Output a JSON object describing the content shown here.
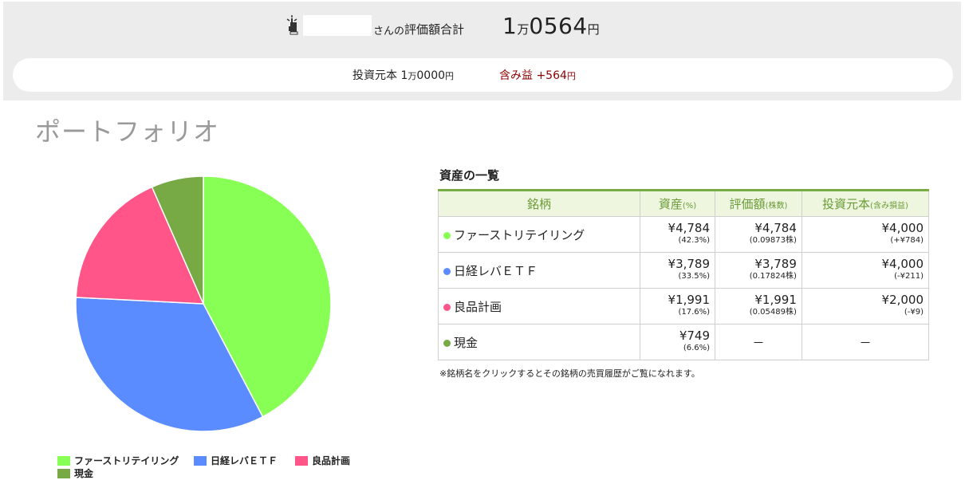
{
  "header": {
    "suffix": "さんの",
    "total_label": "評価額合計",
    "total_value": {
      "man": "1",
      "man_unit": "万",
      "rest": "0564",
      "yen": "円"
    }
  },
  "summary": {
    "principal_label": "投資元本",
    "principal": {
      "man": "1",
      "man_unit": "万",
      "rest": "0000",
      "yen": "円"
    },
    "gain_label": "含み益",
    "gain": {
      "value": "+564",
      "yen": "円"
    }
  },
  "portfolio": {
    "title": "ポートフォリオ"
  },
  "assets": {
    "title": "資産の一覧",
    "columns": [
      {
        "label": "銘柄",
        "sub": ""
      },
      {
        "label": "資産",
        "sub": "(%)"
      },
      {
        "label": "評価額",
        "sub": "(株数)"
      },
      {
        "label": "投資元本",
        "sub": "(含み損益)"
      }
    ],
    "rows": [
      {
        "name": "ファーストリテイリング",
        "color": "#88ff55",
        "asset": "¥4,784",
        "pct": "(42.3%)",
        "eval": "¥4,784",
        "shares": "(0.09873株)",
        "principal": "¥4,000",
        "pl": "(+¥784)"
      },
      {
        "name": "日経レバＥＴＦ",
        "color": "#5a8cff",
        "asset": "¥3,789",
        "pct": "(33.5%)",
        "eval": "¥3,789",
        "shares": "(0.17824株)",
        "principal": "¥4,000",
        "pl": "(-¥211)"
      },
      {
        "name": "良品計画",
        "color": "#ff5588",
        "asset": "¥1,991",
        "pct": "(17.6%)",
        "eval": "¥1,991",
        "shares": "(0.05489株)",
        "principal": "¥2,000",
        "pl": "(-¥9)"
      },
      {
        "name": "現金",
        "color": "#77aa44",
        "asset": "¥749",
        "pct": "(6.6%)",
        "eval": "－",
        "shares": "",
        "principal": "－",
        "pl": ""
      }
    ],
    "note": "※銘柄名をクリックするとその銘柄の売買履歴がご覧になれます。"
  },
  "chart_data": {
    "type": "pie",
    "categories": [
      "ファーストリテイリング",
      "日経レバＥＴＦ",
      "良品計画",
      "現金"
    ],
    "values": [
      42.3,
      33.5,
      17.6,
      6.6
    ],
    "colors": [
      "#88ff55",
      "#5a8cff",
      "#ff5588",
      "#77aa44"
    ],
    "legend": "bottom-left"
  }
}
